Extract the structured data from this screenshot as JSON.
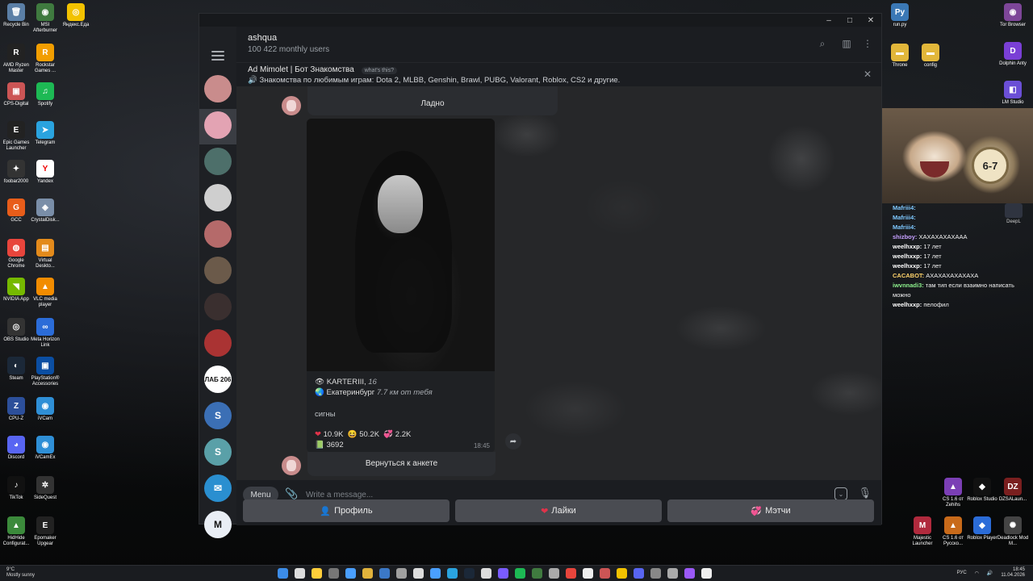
{
  "desktop_left": [
    {
      "label": "Recycle Bin",
      "color": "#5b7fa6",
      "glyph": "🗑"
    },
    {
      "label": "MSI Afterburner",
      "color": "#3f7a3f",
      "glyph": "◉"
    },
    {
      "label": "Яндекс.Еда",
      "color": "#f2c200",
      "glyph": "◎"
    },
    {
      "label": "AMD Ryzen Master",
      "color": "#222",
      "glyph": "R"
    },
    {
      "label": "Rockstar Games ...",
      "color": "#f29e00",
      "glyph": "R"
    },
    {
      "label": "CPS-Digital",
      "color": "#c55",
      "glyph": "▣"
    },
    {
      "label": "Spotify",
      "color": "#1db954",
      "glyph": "♫"
    },
    {
      "label": "Epic Games Launcher",
      "color": "#222",
      "glyph": "E"
    },
    {
      "label": "Telegram",
      "color": "#2aa3df",
      "glyph": "➤"
    },
    {
      "label": "foobar2000",
      "color": "#333",
      "glyph": "✦"
    },
    {
      "label": "Yandex",
      "color": "#fff",
      "glyph": "Y"
    },
    {
      "label": "GCC",
      "color": "#e85d1a",
      "glyph": "G"
    },
    {
      "label": "CrystalDisk...",
      "color": "#7a8ea8",
      "glyph": "◈"
    },
    {
      "label": "Google Chrome",
      "color": "#e8453c",
      "glyph": "◍"
    },
    {
      "label": "Virtual Deskto...",
      "color": "#e38a1b",
      "glyph": "▤"
    },
    {
      "label": "NVIDIA App",
      "color": "#76b900",
      "glyph": "◥"
    },
    {
      "label": "VLC media player",
      "color": "#f28c00",
      "glyph": "▲"
    },
    {
      "label": "OBS Studio",
      "color": "#333",
      "glyph": "◎"
    },
    {
      "label": "Meta Horizon Link",
      "color": "#2b6cd8",
      "glyph": "∞"
    },
    {
      "label": "Steam",
      "color": "#1b2838",
      "glyph": "◐"
    },
    {
      "label": "PlayStation® Accessories",
      "color": "#0b4ea2",
      "glyph": "▣"
    },
    {
      "label": "CPU-Z",
      "color": "#2c4f9a",
      "glyph": "Z"
    },
    {
      "label": "iVCam",
      "color": "#2f8fd6",
      "glyph": "◉"
    },
    {
      "label": "Discord",
      "color": "#5865f2",
      "glyph": "◕"
    },
    {
      "label": "iVCamEx",
      "color": "#2f8fd6",
      "glyph": "◉"
    },
    {
      "label": "TikTok",
      "color": "#111",
      "glyph": "♪"
    },
    {
      "label": "SideQuest",
      "color": "#333",
      "glyph": "✲"
    },
    {
      "label": "HidHide Configurat...",
      "color": "#3b8a3b",
      "glyph": "▲"
    },
    {
      "label": "Epomaker Upgear",
      "color": "#222",
      "glyph": "E"
    }
  ],
  "desktop_right": [
    {
      "label": "run.py",
      "color": "#3b78b5",
      "glyph": "Py"
    },
    {
      "label": "Tor Browser",
      "color": "#7d4698",
      "glyph": "◉"
    },
    {
      "label": "Throne",
      "color": "#e2b73a",
      "glyph": "▬"
    },
    {
      "label": "config",
      "color": "#e2b73a",
      "glyph": "▬"
    },
    {
      "label": "Dolphin Anty",
      "color": "#7a3fd6",
      "glyph": "D"
    },
    {
      "label": "LM Studio",
      "color": "#6b4fd6",
      "glyph": "◧"
    },
    {
      "label": "CS 1.6 от Zehihs",
      "color": "#7b3fb5",
      "glyph": "▲"
    },
    {
      "label": "Roblox Studio",
      "color": "#111",
      "glyph": "◆"
    },
    {
      "label": "DZSALaun...",
      "color": "#7a1f1f",
      "glyph": "DZ"
    },
    {
      "label": "Majestic Launcher",
      "color": "#b02a3d",
      "glyph": "M"
    },
    {
      "label": "CS 1.6 от Русско...",
      "color": "#c86a1a",
      "glyph": "▲"
    },
    {
      "label": "Roblox Player",
      "color": "#2b6cd8",
      "glyph": "◆"
    },
    {
      "label": "Deadlock Mod M...",
      "color": "#444",
      "glyph": "✺"
    }
  ],
  "window": {
    "minimize": "–",
    "maximize": "□",
    "close": "✕"
  },
  "header": {
    "title": "ashqua",
    "subtitle": "100 422 monthly users"
  },
  "chat_list": [
    {
      "color": "#c98c8c",
      "glyph": ""
    },
    {
      "color": "#e3a3b3",
      "glyph": ""
    },
    {
      "color": "#4d6f6a",
      "glyph": ""
    },
    {
      "color": "#cfcfcf",
      "glyph": ""
    },
    {
      "color": "#b56a6a",
      "glyph": ""
    },
    {
      "color": "#6b5a4a",
      "glyph": ""
    },
    {
      "color": "#3a2f2f",
      "glyph": ""
    },
    {
      "color": "#a33",
      "glyph": ""
    },
    {
      "color": "#ffffff",
      "glyph": "ЛАБ 206"
    },
    {
      "color": "#3b6fb5",
      "glyph": "S"
    },
    {
      "color": "#5aa0a8",
      "glyph": "S"
    },
    {
      "color": "#2a8fd0",
      "glyph": "✉"
    },
    {
      "color": "#e9eef5",
      "glyph": "M"
    }
  ],
  "ad": {
    "label": "Ad  Mimolet | Бот Знакомства",
    "whats": "what's this?",
    "text": "🔊 Знакомства по любимым играм: Dota 2, MLBB, Genshin, Brawl, PUBG, Valorant, Roblox, CS2 и другие."
  },
  "messages": {
    "top_button": "Ладно",
    "profile_name": "KARTERIII,",
    "profile_age": "16",
    "profile_city": "Екатеринбург",
    "profile_dist": "7.7 км от тебя",
    "caption": "сигны",
    "r1": "10.9K",
    "r2": "50.2K",
    "r3": "2.2K",
    "r4": "3692",
    "time": "18:45",
    "back_button": "Вернуться к анкете"
  },
  "input": {
    "menu": "Menu",
    "placeholder": "Write a message..."
  },
  "keyboard": {
    "profile": "Профиль",
    "likes": "Лайки",
    "matches": "Мэтчи"
  },
  "overlay": {
    "clock_text": "6-7",
    "deepl": "DeepL",
    "chat": [
      {
        "user": "Mafriii4:",
        "text": "",
        "color": "#7ec8ff"
      },
      {
        "user": "Mafriii4:",
        "text": "",
        "color": "#7ec8ff"
      },
      {
        "user": "Mafriii4:",
        "text": "",
        "color": "#7ec8ff"
      },
      {
        "user": "shizboy:",
        "text": "ХАХАХАХАХААА",
        "color": "#c6a0ff"
      },
      {
        "user": "weelhxxp:",
        "text": "17 лет",
        "color": "#ffffff"
      },
      {
        "user": "weelhxxp:",
        "text": "17 лет",
        "color": "#ffffff"
      },
      {
        "user": "weelhxxp:",
        "text": "17 лет",
        "color": "#ffffff"
      },
      {
        "user": "CACABOT:",
        "text": "АХАХАХАХАХАХА",
        "color": "#ffd36b"
      },
      {
        "user": "iwvnnadi3:",
        "text": "там тип если взаимно написать можно",
        "color": "#8df08d"
      },
      {
        "user": "weelhxxp:",
        "text": "пелофил",
        "color": "#ffffff"
      }
    ]
  },
  "taskbar": {
    "temp": "9°C",
    "weather": "Mostly sunny",
    "lang": "РУС",
    "time": "18:45",
    "date": "11.04.2026"
  }
}
